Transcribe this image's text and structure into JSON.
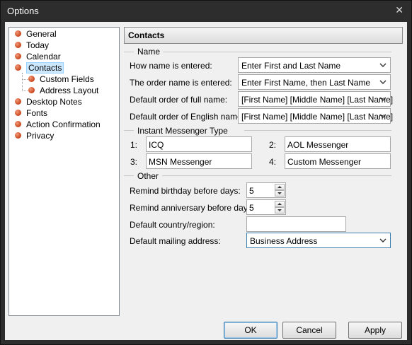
{
  "window": {
    "title": "Options",
    "close_glyph": "✕"
  },
  "tree": {
    "items": [
      {
        "label": "General"
      },
      {
        "label": "Today"
      },
      {
        "label": "Calendar"
      },
      {
        "label": "Contacts",
        "selected": true
      },
      {
        "label": "Custom Fields",
        "child": true
      },
      {
        "label": "Address Layout",
        "child": true
      },
      {
        "label": "Desktop Notes"
      },
      {
        "label": "Fonts"
      },
      {
        "label": "Action Confirmation"
      },
      {
        "label": "Privacy"
      }
    ]
  },
  "panel": {
    "title": "Contacts",
    "name_group": {
      "label": "Name",
      "rows": [
        {
          "label": "How name is entered:",
          "value": "Enter First and Last Name"
        },
        {
          "label": "The order name is entered:",
          "value": "Enter First Name, then Last Name"
        },
        {
          "label": "Default order of full name:",
          "value": "[First Name] [Middle Name] [Last Name]"
        },
        {
          "label": "Default order of English name:",
          "value": "[First Name] [Middle Name] [Last Name]"
        }
      ]
    },
    "im_group": {
      "label": "Instant Messenger Type",
      "fields": [
        {
          "label": "1:",
          "value": "ICQ"
        },
        {
          "label": "2:",
          "value": "AOL Messenger"
        },
        {
          "label": "3:",
          "value": "MSN Messenger"
        },
        {
          "label": "4:",
          "value": "Custom Messenger"
        }
      ]
    },
    "other_group": {
      "label": "Other",
      "birthday_label": "Remind birthday before days:",
      "birthday_value": "5",
      "anniversary_label": "Remind anniversary before days:",
      "anniversary_value": "5",
      "country_label": "Default country/region:",
      "country_value": "",
      "mailing_label": "Default mailing address:",
      "mailing_value": "Business Address"
    }
  },
  "buttons": {
    "ok": "OK",
    "cancel": "Cancel",
    "apply": "Apply"
  },
  "colors": {
    "accent": "#3c7fb1",
    "selection": "#cce8ff",
    "bullet": "#c8431c"
  }
}
